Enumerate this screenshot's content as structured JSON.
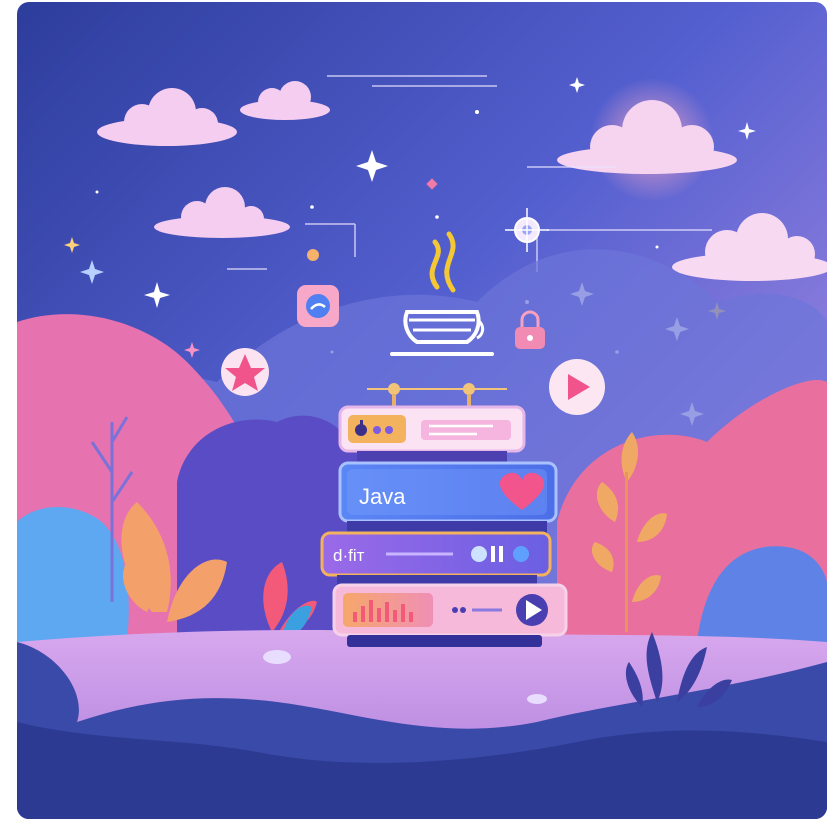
{
  "illustration": {
    "panels": {
      "top": {
        "label": ""
      },
      "middle": {
        "label": "Java"
      },
      "lower": {
        "label": "d·fіт"
      },
      "bottom": {
        "label": ""
      }
    }
  },
  "colors": {
    "sky_top": "#2e3f9e",
    "sky_mid": "#5b63d6",
    "sky_right": "#d9a6e8",
    "hill_pink": "#e66fa8",
    "hill_purple": "#5b4fc8",
    "ground": "#c79ae6",
    "foreground": "#2f3c96",
    "panel_pink": "#f3a1d6",
    "panel_blue": "#4f7cf0",
    "panel_yellow": "#f2b560",
    "heart": "#f2548c",
    "java_cup": "#ffffff",
    "steam": "#f4c834"
  },
  "icons": [
    "java-cup-icon",
    "apple-icon",
    "heart-icon",
    "play-icon",
    "lock-icon",
    "chat-icon",
    "star-badge-icon",
    "pause-icon",
    "equalizer-icon",
    "sun-icon"
  ]
}
